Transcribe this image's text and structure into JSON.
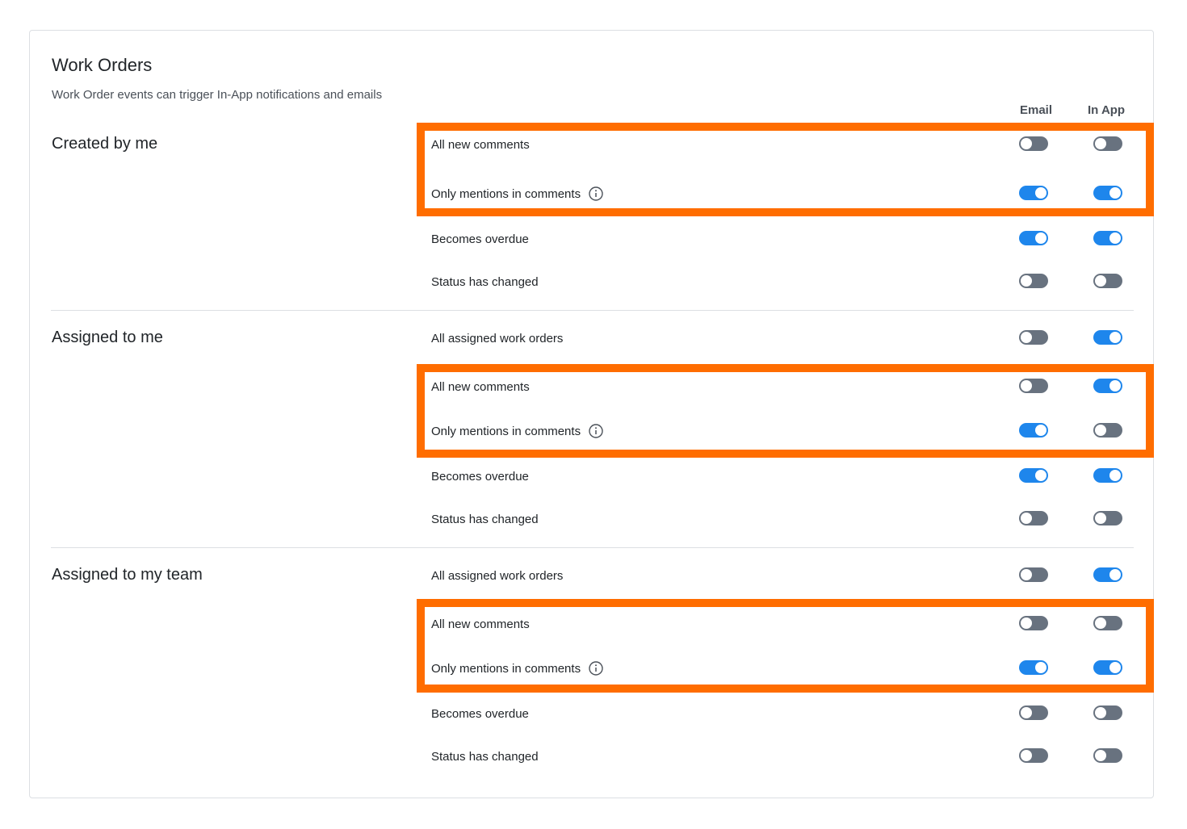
{
  "header": {
    "title": "Work Orders",
    "subtitle": "Work Order events can trigger In-App notifications and emails",
    "col_email": "Email",
    "col_inapp": "In App"
  },
  "sections": [
    {
      "title": "Created by me",
      "rows": [
        {
          "label": "All new comments",
          "email": false,
          "in_app": false,
          "info": false
        },
        {
          "label": "Only mentions in comments",
          "email": true,
          "in_app": true,
          "info": true
        },
        {
          "label": "Becomes overdue",
          "email": true,
          "in_app": true,
          "info": false
        },
        {
          "label": "Status has changed",
          "email": false,
          "in_app": false,
          "info": false
        }
      ]
    },
    {
      "title": "Assigned to me",
      "rows": [
        {
          "label": "All assigned work orders",
          "email": false,
          "in_app": true,
          "info": false
        },
        {
          "label": "All new comments",
          "email": false,
          "in_app": true,
          "info": false
        },
        {
          "label": "Only mentions in comments",
          "email": true,
          "in_app": false,
          "info": true
        },
        {
          "label": "Becomes overdue",
          "email": true,
          "in_app": true,
          "info": false
        },
        {
          "label": "Status has changed",
          "email": false,
          "in_app": false,
          "info": false
        }
      ]
    },
    {
      "title": "Assigned to my team",
      "rows": [
        {
          "label": "All assigned work orders",
          "email": false,
          "in_app": true,
          "info": false
        },
        {
          "label": "All new comments",
          "email": false,
          "in_app": false,
          "info": false
        },
        {
          "label": "Only mentions in comments",
          "email": true,
          "in_app": true,
          "info": true
        },
        {
          "label": "Becomes overdue",
          "email": false,
          "in_app": false,
          "info": false
        },
        {
          "label": "Status has changed",
          "email": false,
          "in_app": false,
          "info": false
        }
      ]
    }
  ],
  "colors": {
    "toggle_on": "#1e86ec",
    "toggle_off": "#68727f",
    "highlight": "#ff6d00"
  }
}
